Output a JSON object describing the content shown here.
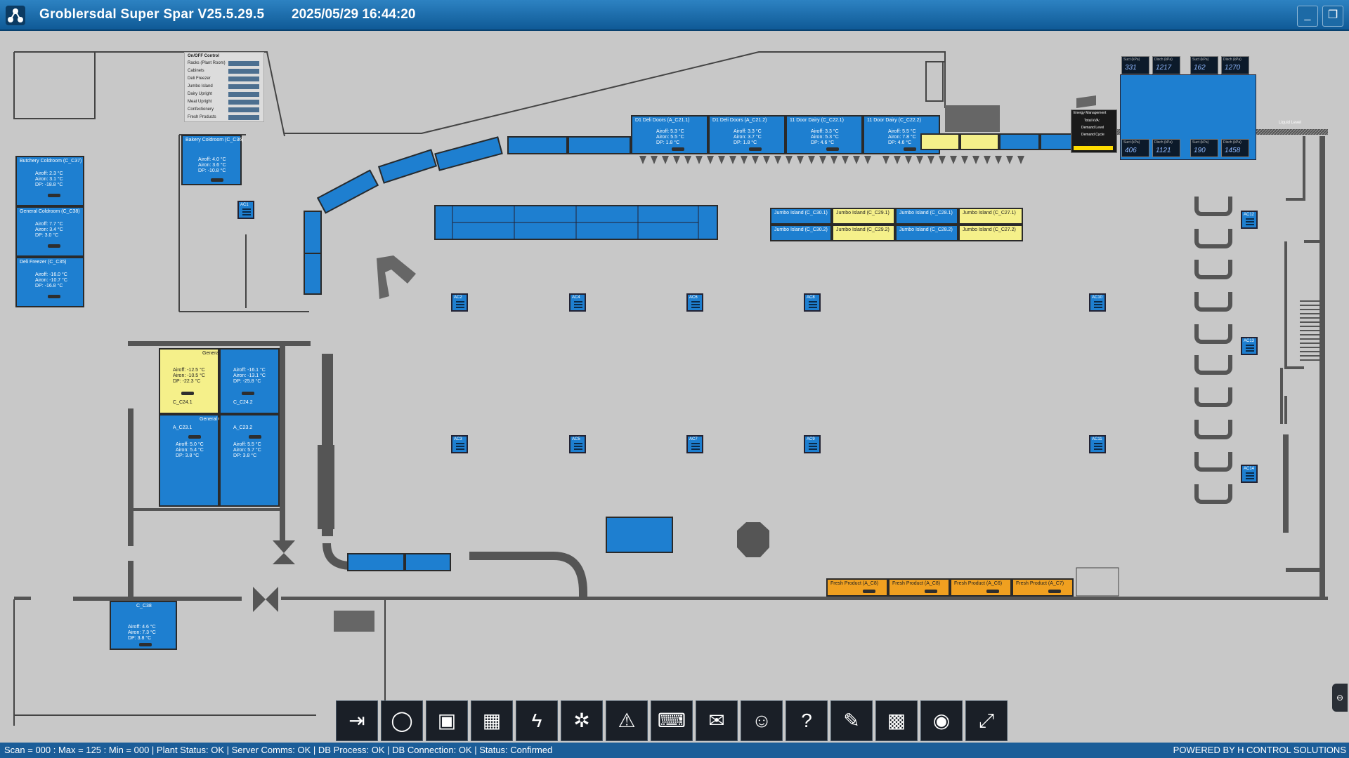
{
  "titlebar": {
    "title": "Groblersdal Super Spar V25.5.29.5",
    "timestamp": "2025/05/29 16:44:20",
    "minimize_icon": "minimize-icon",
    "restore_icon": "restore-icon"
  },
  "onoff_control": {
    "title": "On/OFF Control",
    "rows": [
      "Racks (Plant Room)",
      "Cabinets",
      "Deli Freezer",
      "Jumbo Island",
      "Dairy Upright",
      "Meat Upright",
      "Confectionery",
      "Fresh Products"
    ]
  },
  "cases": {
    "butchery_cold": {
      "label": "Butchery Coldroom (C_C37)",
      "air": "Airoff: 2.3 °C",
      "on": "Airon: 3.1 °C",
      "dp": "DP: -18.8 °C"
    },
    "general_cold": {
      "label": "General Coldroom (C_C38)",
      "air": "Airoff: 7.7 °C",
      "on": "Airon: 3.4 °C",
      "dp": "DP: 3.0 °C"
    },
    "deli_freezer": {
      "label": "Deli Freezer (C_C35)",
      "air": "Airoff: -16.0 °C",
      "on": "Airon: -10.7 °C",
      "dp": "DP: -16.8 °C"
    },
    "bakery_cold": {
      "label": "Bakery Coldroom (C_C36)",
      "air": "Airoff: 4.0 °C",
      "on": "Airon: 3.6 °C",
      "dp": "DP: -10.8 °C"
    },
    "general_freezer": {
      "label": "General Freezer",
      "left_air": "Airoff: -12.5 °C",
      "left_on": "Airon: -10.5 °C",
      "left_dp": "DP: -22.3 °C",
      "right_air": "Airoff: -16.1 °C",
      "right_on": "Airon: -13.1 °C",
      "right_dp": "DP: -25.8 °C",
      "tag_left": "C_C24.1",
      "tag_right": "C_C24.2"
    },
    "general_coldroom2": {
      "label": "General Coldroom",
      "tag_left": "A_C23.1",
      "tag_right": "A_C23.2",
      "left_air": "Airoff: 5.0 °C",
      "left_on": "Airon: 5.4 °C",
      "left_dp": "DP: 3.8 °C",
      "right_air": "Airoff: 5.5 °C",
      "right_on": "Airon: 5.7 °C",
      "right_dp": "DP: 3.8 °C"
    },
    "c_c38": {
      "label": "C_C38",
      "air": "Airoff: 4.6 °C",
      "on": "Airon: 7.3 °C",
      "dp": "DP: 3.8 °C"
    },
    "deli_doors": [
      {
        "label": "D1 Deli Doors (A_C21.1)",
        "air": "Airoff: 5.3 °C",
        "on": "Airon: 5.5 °C",
        "dp": "DP: 1.8 °C"
      },
      {
        "label": "D1 Deli Doors (A_C21.2)",
        "air": "Airoff: 3.3 °C",
        "on": "Airon: 3.7 °C",
        "dp": "DP: 1.8 °C"
      },
      {
        "label": "11 Door Dairy (C_C22.1)",
        "air": "Airoff: 3.3 °C",
        "on": "Airon: 5.3 °C",
        "dp": "DP: 4.6 °C"
      },
      {
        "label": "11 Door Dairy (C_C22.2)",
        "air": "Airoff: 5.5 °C",
        "on": "Airon: 7.8 °C",
        "dp": "DP: 4.6 °C"
      }
    ],
    "fresh_products": [
      "Fresh Product (A_C8)",
      "Fresh Product (A_C8)",
      "Fresh Product (A_C6)",
      "Fresh Product (A_C7)"
    ],
    "jumbo_islands": [
      "Jumbo Island (C_C30.1)",
      "Jumbo Island (C_C30.2)",
      "Jumbo Island (C_C29.1)",
      "Jumbo Island (C_C29.2)",
      "Jumbo Island (C_C28.1)",
      "Jumbo Island (C_C28.2)",
      "Jumbo Island (C_C27.1)",
      "Jumbo Island (C_C27.2)"
    ]
  },
  "aircons": [
    "AC1",
    "AC4",
    "AC6",
    "AC8",
    "AC10",
    "AC2",
    "AC3",
    "AC5",
    "AC7",
    "AC9",
    "AC11",
    "AC12",
    "AC13",
    "AC14"
  ],
  "racks": {
    "rack_a": {
      "suct": "331",
      "disch": "1217"
    },
    "rack_c": {
      "suct": "162",
      "disch": "1270"
    },
    "rack_b": {
      "suct": "406",
      "disch": "1121"
    },
    "rack_d": {
      "suct": "190",
      "disch": "1458"
    },
    "suct_label": "Suct (kPa)",
    "disch_label": "Disch (kPa)",
    "liquid_level": "Liquid Level"
  },
  "energy_management": {
    "title": "Energy Management",
    "total": "Total kVA:",
    "demand_level": "Demand Level",
    "demand_cycle": "Demand Cycle",
    "state": "Standard"
  },
  "toolbar": {
    "buttons": [
      "logout-icon",
      "refresh-icon",
      "save-icon",
      "calendar-icon",
      "power-icon",
      "defrost-icon",
      "alarm-icon",
      "keyboard-icon",
      "mail-icon",
      "user-settings-icon",
      "help-icon",
      "tools-icon",
      "qr-code-icon",
      "view-icon",
      "maximize-icon"
    ]
  },
  "statusbar": {
    "left": "Scan = 000 : Max = 125 : Min = 000  |  Plant Status: OK  |  Server Comms: OK  |  DB Process: OK  |  DB Connection:  OK  |  Status: Confirmed",
    "right": "POWERED BY H CONTROL SOLUTIONS"
  },
  "colors": {
    "case_blue": "#1e7fd0",
    "case_yellow": "#f5f08a",
    "case_orange": "#f0a020",
    "titlebar": "#1b6db0",
    "statusbar": "#1b5d98"
  }
}
